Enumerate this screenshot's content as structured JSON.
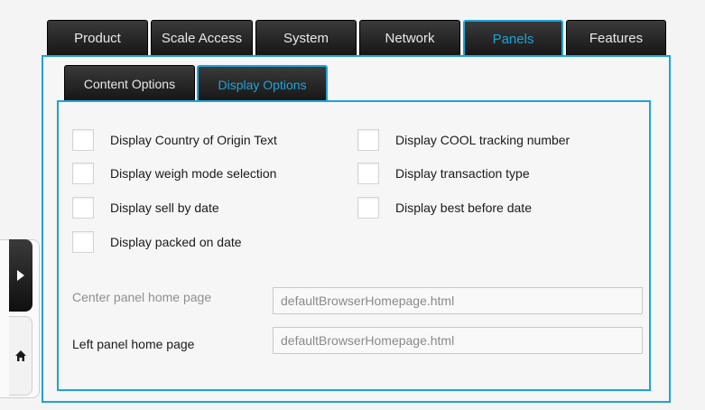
{
  "top_tabs": [
    {
      "label": "Product"
    },
    {
      "label": "Scale Access"
    },
    {
      "label": "System"
    },
    {
      "label": "Network"
    },
    {
      "label": "Panels",
      "active": true
    },
    {
      "label": "Features"
    }
  ],
  "sub_tabs": [
    {
      "label": "Content Options"
    },
    {
      "label": "Display Options",
      "active": true
    }
  ],
  "display_options": {
    "country_of_origin": {
      "label": "Display Country of Origin Text",
      "checked": false
    },
    "weigh_mode": {
      "label": "Display weigh mode selection",
      "checked": false
    },
    "sell_by_date": {
      "label": "Display sell by date",
      "checked": false
    },
    "packed_on_date": {
      "label": "Display packed on date",
      "checked": false
    },
    "cool_tracking": {
      "label": "Display COOL tracking number",
      "checked": false
    },
    "transaction_type": {
      "label": "Display transaction type",
      "checked": false
    },
    "best_before": {
      "label": "Display best before date",
      "checked": false
    }
  },
  "fields": {
    "center_home": {
      "label": "Center panel home page",
      "value": "defaultBrowserHomepage.html"
    },
    "left_home": {
      "label": "Left panel home page",
      "value": "defaultBrowserHomepage.html"
    }
  },
  "icons": {
    "expand": "chevron-right-icon",
    "home": "home-icon"
  },
  "colors": {
    "accent": "#1fa3d6",
    "tab_dark": "#1c1c1c",
    "background": "#f4f4f4"
  }
}
